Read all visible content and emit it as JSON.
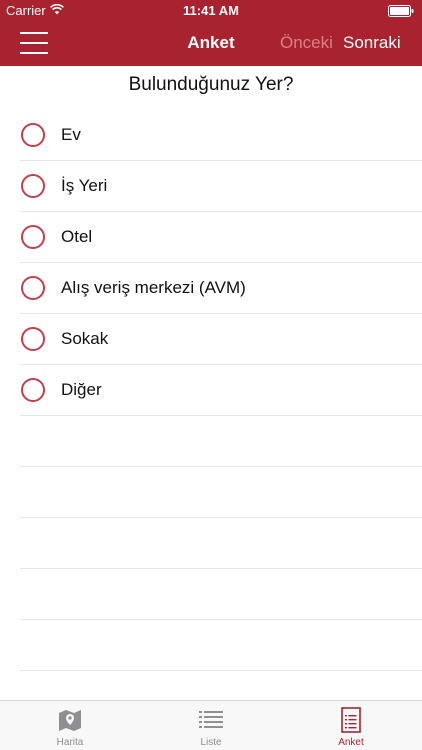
{
  "status_bar": {
    "carrier": "Carrier",
    "time": "11:41 AM"
  },
  "nav": {
    "title": "Anket",
    "prev_label": "Önceki",
    "next_label": "Sonraki"
  },
  "question": "Bulunduğunuz Yer?",
  "options": [
    {
      "label": "Ev"
    },
    {
      "label": "İş Yeri"
    },
    {
      "label": "Otel"
    },
    {
      "label": "Alış veriş merkezi (AVM)"
    },
    {
      "label": "Sokak"
    },
    {
      "label": "Diğer"
    }
  ],
  "tabs": [
    {
      "label": "Harita",
      "icon": "map-icon"
    },
    {
      "label": "Liste",
      "icon": "list-icon"
    },
    {
      "label": "Anket",
      "icon": "survey-icon"
    }
  ],
  "active_tab": "Anket",
  "colors": {
    "brand": "#a8232f",
    "radio": "#c0414c",
    "tab_inactive": "#8e8e93"
  }
}
